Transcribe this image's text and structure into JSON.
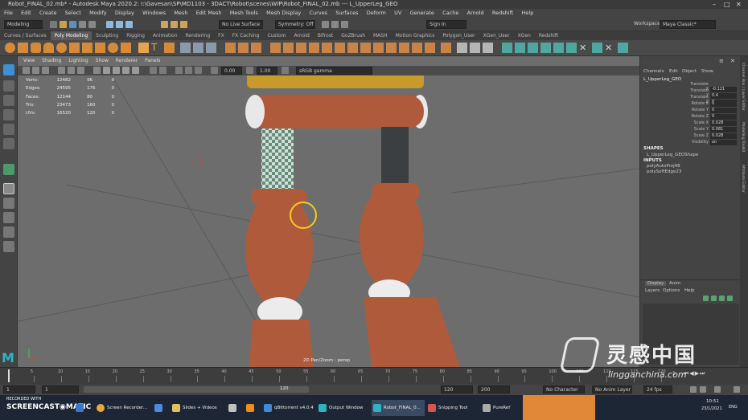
{
  "window": {
    "title": "Robot_FINAL_02.mb* - Autodesk Maya 2020.2: I:\\Gavesan\\SP\\MD1103 - 3DACT\\Robot\\scenes\\WIP\\Robot_FINAL_02.mb --- L_UpperLeg_GEO"
  },
  "menubar": [
    "File",
    "Edit",
    "Create",
    "Select",
    "Modify",
    "Display",
    "Windows",
    "Mesh",
    "Edit Mesh",
    "Mesh Tools",
    "Mesh Display",
    "Curves",
    "Surfaces",
    "Deform",
    "UV",
    "Generate",
    "Cache",
    "Arnold",
    "Redshift",
    "Help"
  ],
  "statusline": {
    "mode": "Modeling",
    "live_surface": "No Live Surface",
    "symmetry": "Symmetry: Off",
    "sign_in": "Sign In",
    "workspace_label": "Workspace:",
    "workspace": "Maya Classic*"
  },
  "shelf_tabs": [
    "Curves / Surfaces",
    "Poly Modeling",
    "Sculpting",
    "Rigging",
    "Animation",
    "Rendering",
    "FX",
    "FX Caching",
    "Custom",
    "Arnold",
    "Bifrost",
    "GoZBrush",
    "MASH",
    "Motion Graphics",
    "Polygon_User",
    "XGen_User",
    "XGen",
    "Redshift"
  ],
  "viewport": {
    "menu": [
      "View",
      "Shading",
      "Lighting",
      "Show",
      "Renderer",
      "Panels"
    ],
    "near_value": "0.00",
    "far_value": "1.00",
    "color_space": "sRGB gamma",
    "camera_label": "2D Pan/Zoom : persp",
    "hud": [
      {
        "label": "Verts:",
        "a": "12482",
        "b": "96",
        "c": "0"
      },
      {
        "label": "Edges:",
        "a": "24595",
        "b": "176",
        "c": "0"
      },
      {
        "label": "Faces:",
        "a": "12144",
        "b": "80",
        "c": "0"
      },
      {
        "label": "Tris:",
        "a": "23473",
        "b": "160",
        "c": "0"
      },
      {
        "label": "UVs:",
        "a": "16520",
        "b": "120",
        "c": "0"
      }
    ]
  },
  "channel_box": {
    "tabs": [
      "Channels",
      "Edit",
      "Object",
      "Show"
    ],
    "object": "L_UpperLeg_GEO",
    "attributes": [
      {
        "label": "Translate X",
        "value": "-0.121"
      },
      {
        "label": "Translate Y",
        "value": "0.4"
      },
      {
        "label": "Translate Z",
        "value": "0"
      },
      {
        "label": "Rotate X",
        "value": "0"
      },
      {
        "label": "Rotate Y",
        "value": "0"
      },
      {
        "label": "Rotate Z",
        "value": "0"
      },
      {
        "label": "Scale X",
        "value": "0.028"
      },
      {
        "label": "Scale Y",
        "value": "0.081"
      },
      {
        "label": "Scale Z",
        "value": "0.028"
      },
      {
        "label": "Visibility",
        "value": "on"
      }
    ],
    "shapes_header": "SHAPES",
    "shape": "L_UpperLeg_GEOShape",
    "inputs_header": "INPUTS",
    "inputs": [
      "polyAutoProj48",
      "polySoftEdge23"
    ]
  },
  "layer_editor": {
    "tabs": [
      "Display",
      "Anim"
    ],
    "menu": [
      "Layers",
      "Options",
      "Help"
    ]
  },
  "side_tabs": [
    "Channel Box / Layer Editor",
    "Modelling Toolkit",
    "Attribute Editor"
  ],
  "timeline": {
    "ticks": [
      "5",
      "10",
      "15",
      "20",
      "25",
      "30",
      "35",
      "40",
      "45",
      "50",
      "55",
      "60",
      "65",
      "70",
      "75",
      "80",
      "85",
      "90",
      "95",
      "100",
      "105",
      "110",
      "115",
      "120"
    ],
    "current_frame": "1"
  },
  "range": {
    "start": "1",
    "inner_start": "1",
    "slider_value": "120",
    "inner_end": "120",
    "end": "200",
    "character_set": "No Character Set",
    "anim_layer": "No Anim Layer",
    "fps": "24 fps"
  },
  "taskbar": {
    "recorded_with": "RECORDED WITH",
    "brand": "SCREENCAST",
    "brand2": "MATIC",
    "items": [
      "Screen Recorder...",
      "Slides + Videos",
      "qBittorrent v4.0.4",
      "Output Window",
      "Robot_FINAL_0...",
      "Snipping Tool",
      "PureRef"
    ],
    "clock_time": "10:51",
    "clock_date": "23/1/2021",
    "lang": "ENG"
  },
  "watermark": {
    "cn": "灵感中国",
    "url": "lingganchina.com"
  },
  "colors": {
    "leg_orange": "#b05a3c",
    "joint_white": "#e8e8e8",
    "rod_dark": "#3c3f42",
    "cursor_ring": "#f2cc1e",
    "viewport_bg": "#6d6d6d",
    "maya_m": "#2fb3c4"
  }
}
